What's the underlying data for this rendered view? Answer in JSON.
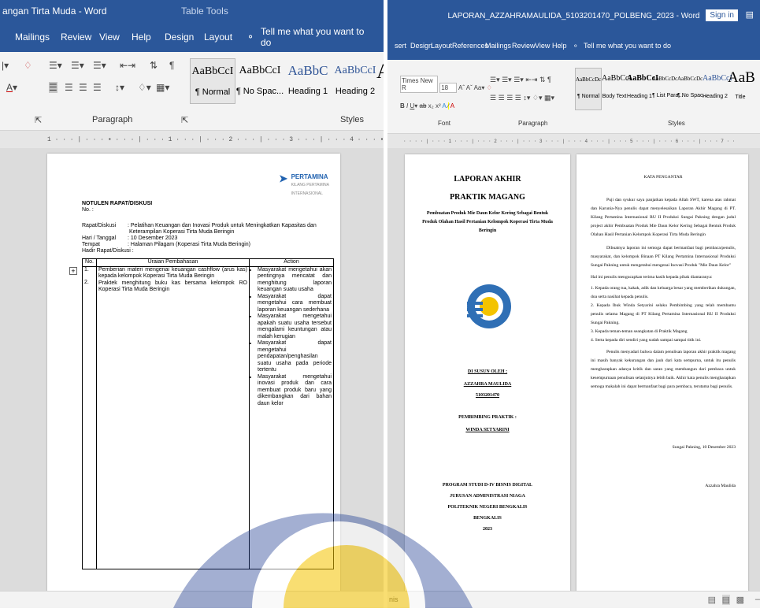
{
  "left": {
    "title": "angan Tirta Muda  -  Word",
    "table_tools": "Table Tools",
    "tabs": [
      "Mailings",
      "Review",
      "View",
      "Help",
      "Design",
      "Layout"
    ],
    "tellme": "Tell me what you want to do",
    "styles": [
      {
        "preview": "AaBbCcI",
        "name": "¶ Normal"
      },
      {
        "preview": "AaBbCcI",
        "name": "¶ No Spac..."
      },
      {
        "preview": "AaBbC",
        "name": "Heading 1"
      },
      {
        "preview": "AaBbCcI",
        "name": "Heading 2"
      }
    ],
    "group_paragraph": "Paragraph",
    "group_styles": "Styles",
    "ruler": "1 · · · | · · · ▪ · · · | · · · 1 · · · | · · · 2 · · · | · · · 3 · · · | · · · 4 · · · ▪ · · · 5 · · · | · · · 6 · · · | · · · ▪7 ·",
    "doc": {
      "logo_name": "PERTAMINA",
      "logo_sub1": "KILANG PERTAMINA",
      "logo_sub2": "INTERNASIONAL",
      "heading": "NOTULEN RAPAT/DISKUSI",
      "no": "No. :",
      "rows": [
        {
          "k": "Rapat/Diskusi",
          "v": ": Pelatihan Keuangan dan Inovasi Produk untuk Meningkatkan Kapasitas dan"
        },
        {
          "k": "",
          "v": "  Keterampilan Koperasi Tirta Muda Beringin"
        },
        {
          "k": "Hari / Tanggal",
          "v": ": 10 Desember 2023"
        },
        {
          "k": "Tempat",
          "v": ": Halaman Pilagam (Koperasi Tirta Muda Beringin)"
        }
      ],
      "hadir": "Hadir Rapat/Diskusi :",
      "table": {
        "headers": [
          "No.",
          "Uraian Pembahasan",
          "Action"
        ],
        "nums": [
          "1.",
          "2."
        ],
        "items": [
          "Pemberian materi mengenai keuangan cashflow (arus kas) kepada kelompok Koperasi Tirta Muda Beringin",
          "Praktek menghitung buku kas bersama kelompok RO Koperasi Tirta Muda Beringin"
        ],
        "actions": [
          "Masyarakat mengetahui akan pentingnya mencatat dan menghitung laporan keuangan suatu usaha",
          "Masyarakat dapat mengetahui cara membuat laporan keuangan sederhana",
          "Masyarakat mengetahui apakah suatu usaha tersebut mengalami keuntungan atau malah kerugian",
          "Masyarakat dapat mengetahui pendapatan/penghasilan suatu usaha pada periode tertentu",
          "Masyarakat mengetahui inovasi produk dan cara membuat produk baru yang dikembangkan dari bahan daun kelor"
        ]
      }
    }
  },
  "right": {
    "title": "LAPORAN_AZZAHRAMAULIDA_5103201470_POLBENG_2023  -  Word",
    "signin": "Sign in",
    "tabs": [
      "sert",
      "Design",
      "Layout",
      "References",
      "Mailings",
      "Review",
      "View",
      "Help"
    ],
    "tellme": "Tell me what you want to do",
    "font_name": "Times New R",
    "font_size": "18",
    "styles": [
      {
        "preview": "AaBbCcDc",
        "name": "¶ Normal"
      },
      {
        "preview": "AaBbCcI",
        "name": "Body Text"
      },
      {
        "preview": "AaBbCcI",
        "name": "Heading 1"
      },
      {
        "preview": "AaBbCcDc",
        "name": "¶ List Para..."
      },
      {
        "preview": "AaBbCcDc",
        "name": "¶ No Spac..."
      },
      {
        "preview": "AaBbCcI",
        "name": "Heading 2"
      },
      {
        "preview": "AaB",
        "name": "Title"
      }
    ],
    "group_font": "Font",
    "group_paragraph": "Paragraph",
    "group_styles": "Styles",
    "ruler": "· · · · | · · · 1 · · · | · · · 2 · · · | · · · 3 · · · | · · · 4 · · · | · · · 5 · · · | · · · 6 · · · | · · · 7 · ·",
    "cover": {
      "t1": "LAPORAN AKHIR",
      "t2": "PRAKTIK MAGANG",
      "sub": "Pembuatan Produk Mie Daun Kelor Kering Sebagai Bentuk Produk Olahan Hasil Pertanian Kelompok Koperasi Tirta Muda Beringin",
      "disusun": "DI SUSUN OLEH :",
      "name": "AZZAHRA MAULIDA",
      "nim": "5103201470",
      "pemb": "PEMBIMBING PRAKTIK :",
      "pemb_name": "WINDA SETYARINI",
      "f1": "PROGRAM STUDI D-IV BISNIS DIGITAL",
      "f2": "JURUSAN ADMINISTRASI NIAGA",
      "f3": "POLITEKNIK NEGERI BENGKALIS",
      "f4": "BENGKALIS",
      "f5": "2023"
    },
    "kata": {
      "title": "KATA PENGANTAR",
      "p1": "Puji dan syukur saya panjatkan kepada Allah SWT, karena atas rahmat dan Karunia-Nya penulis dapat menyelesaikan Laporan Akhir Magang di PT. Kilang Pertamina Internasional RU II Produksi Sungai Pakning dengan judul project akhir  Pembuatan Produk Mie Daun Kelor Kering Sebagai Bentuk Produk Olahan Hasil Pertanian Kelompok Koperasi Tirta Muda Beringin",
      "p2": "Dibuatnya laporan ini semoga dapat bermanfaat bagi pembaca/penulis, masyarakat, dan kelompok Binaan PT Kilang Pertamina Internasional Produksi Sungai Pakning untuk mengetahui mengenai Inovasi Produk \"Mie Daun Kelor\"",
      "p3": "Hal ini penulis mengucapkan terima kasih kepada pihak diantaranya:",
      "list": [
        "1.  Kepada orang tua, kakak, adik dan keluarga besar yang memberikan dukungan, doa serta nasihat kepada penulis.",
        "2.  Kepada Ibuk Winda Setyarini selaku Pembimbing yang telah membantu penulis selama Magang di PT Kilang Pertamina Internasional RU II Produksi Sungai Pakning.",
        "3.  Kepada teman-teman seangkatan di Praktik Magang",
        "4.  Serta kepada diri sendiri yang sudah sampai sampai titik ini."
      ],
      "p4": "Penulis menyadari bahwa dalam penulisan laporan akhir praktik magang ini masih banyak kekurangan dan jauh dari kata sempurna, untuk itu penulis mengharapkan adanya kritik dan saran yang membangun dari pembaca untuk kesempurnaan penulisan selanjutnya lebih baik. Akhir kata penulis mengharapkan semoga makalah ini dapat bermanfaat bagi para pembaca, terutama bagi penulis.",
      "place": "Sungai Pakning, 10 Desember 2023",
      "sign": "Azzahra Maulida"
    },
    "status_left": "nis"
  },
  "colors": {
    "word_blue": "#2b579a",
    "ribbon": "#f3f3f3",
    "canvas": "#dcdcdc",
    "watermark_blue": "#1f3d93",
    "watermark_gold": "#f5c400"
  }
}
